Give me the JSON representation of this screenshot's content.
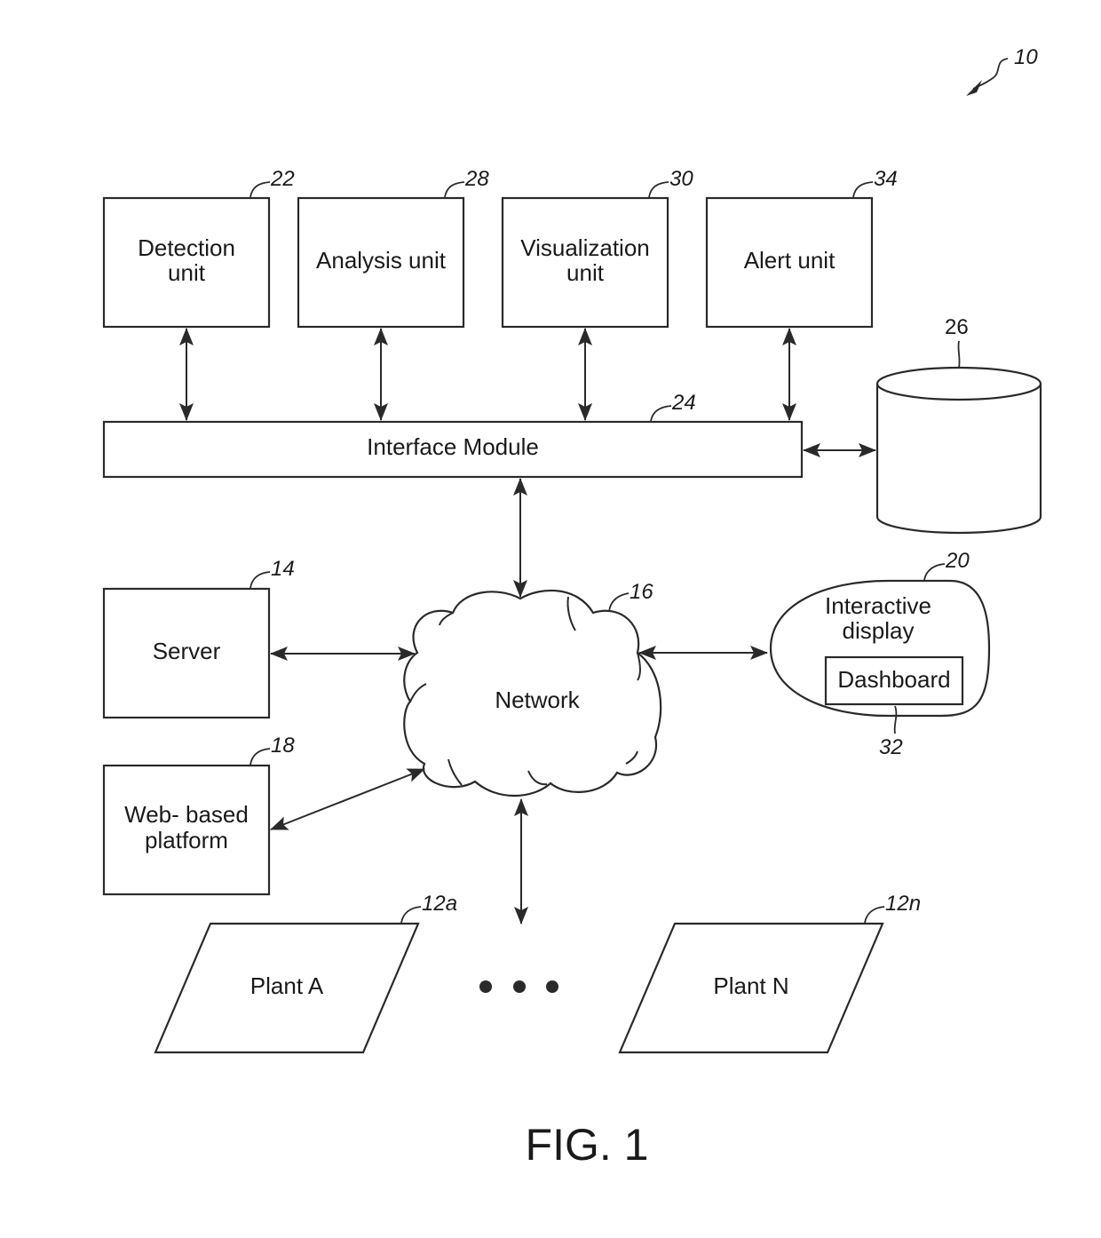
{
  "figure": {
    "caption": "FIG. 1",
    "system_ref": "10",
    "ink_color": "#2a2a2a",
    "background": "#ffffff"
  },
  "units": {
    "detection": {
      "lines": [
        "Detection",
        "unit"
      ],
      "ref": "22"
    },
    "analysis": {
      "lines": [
        "Analysis unit"
      ],
      "ref": "28"
    },
    "visualization": {
      "lines": [
        "Visualization",
        "unit"
      ],
      "ref": "30"
    },
    "alert": {
      "lines": [
        "Alert unit"
      ],
      "ref": "34"
    }
  },
  "interface_module": {
    "label": "Interface Module",
    "ref": "24"
  },
  "database": {
    "ref": "26"
  },
  "network": {
    "label": "Network",
    "ref": "16"
  },
  "server": {
    "label": "Server",
    "ref": "14"
  },
  "web_platform": {
    "lines": [
      "Web- based",
      "platform"
    ],
    "ref": "18"
  },
  "interactive_display": {
    "lines": [
      "Interactive",
      "display"
    ],
    "ref": "20",
    "dashboard": {
      "label": "Dashboard",
      "ref": "32"
    }
  },
  "plants": [
    {
      "label": "Plant A",
      "ref": "12a"
    },
    {
      "label": "Plant N",
      "ref": "12n"
    }
  ],
  "ellipsis_dots": 3
}
